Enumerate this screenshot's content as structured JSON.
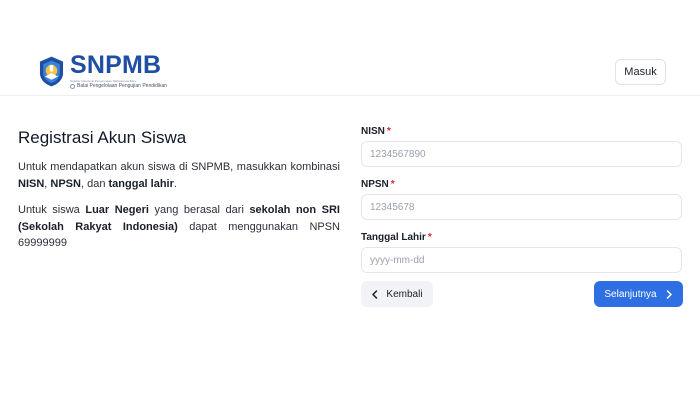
{
  "header": {
    "logo_text": "SNPMB",
    "logo_subtitle_top": "Seleksi Nasional Penerimaan Mahasiswa Baru",
    "logo_subtitle": "Balai Pengelolaan Pengujian Pendidikan",
    "login_label": "Masuk"
  },
  "intro": {
    "title": "Registrasi Akun Siswa",
    "para1_text1": "Untuk mendapatkan akun siswa di SNPMB, masukkan kombinasi ",
    "para1_nisn": "NISN",
    "para1_sep1": ", ",
    "para1_npsn": "NPSN",
    "para1_sep2": ", dan ",
    "para1_dob": "tanggal lahir",
    "para1_end": ".",
    "para2_text1": "Untuk siswa ",
    "para2_luar": "Luar Negeri",
    "para2_text2": " yang berasal dari ",
    "para2_sekolah": "sekolah non SRI (Sekolah Rakyat Indonesia)",
    "para2_text3": " dapat menggunakan NPSN 69999999"
  },
  "form": {
    "nisn_label": "NISN",
    "nisn_placeholder": "1234567890",
    "nisn_value": "",
    "npsn_label": "NPSN",
    "npsn_placeholder": "12345678",
    "npsn_value": "",
    "dob_label": "Tanggal Lahir",
    "dob_placeholder": "yyyy-mm-dd",
    "dob_value": "",
    "required_mark": "*"
  },
  "actions": {
    "back_label": "Kembali",
    "next_label": "Selanjutnya",
    "back_icon": "chevron-left-icon",
    "next_icon": "chevron-right-icon"
  },
  "colors": {
    "accent": "#2f6fe4",
    "brand": "#1f4fa3",
    "required": "#dc2626"
  }
}
